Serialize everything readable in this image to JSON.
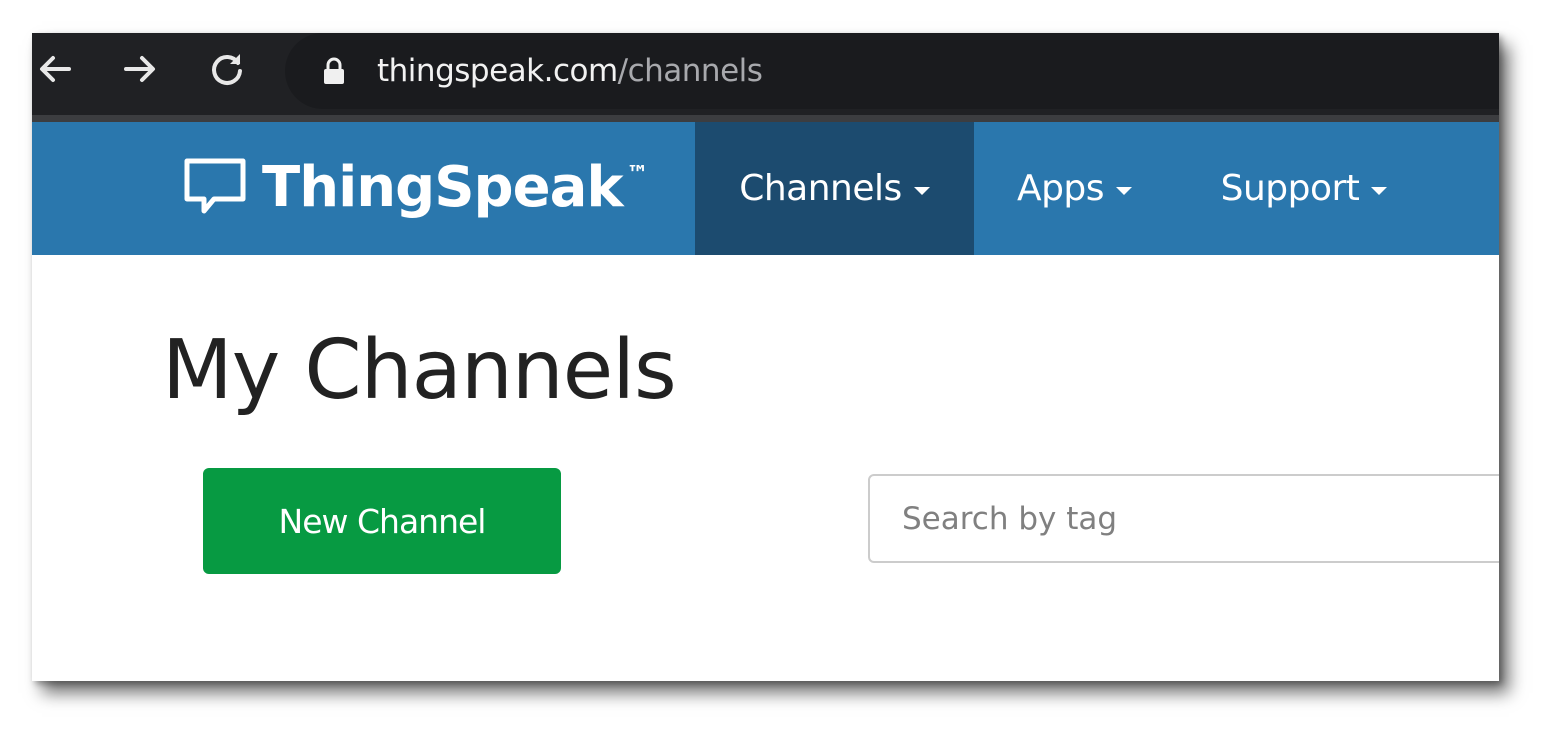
{
  "browser": {
    "url_host": "thingspeak.com",
    "url_path": "/channels"
  },
  "navbar": {
    "brand_name": "ThingSpeak",
    "brand_tm": "™",
    "items": [
      {
        "label": "Channels",
        "active": true
      },
      {
        "label": "Apps",
        "active": false
      },
      {
        "label": "Support",
        "active": false
      }
    ]
  },
  "main": {
    "title": "My Channels",
    "new_channel_label": "New Channel",
    "search_placeholder": "Search by tag"
  },
  "colors": {
    "navbar_bg": "#2a77ad",
    "navbar_active_bg": "#1c4b6f",
    "button_green": "#079a42",
    "browser_bar_bg": "#202124"
  },
  "icons": {
    "back": "arrow-left-icon",
    "forward": "arrow-right-icon",
    "reload": "reload-icon",
    "lock": "lock-icon",
    "logo": "speech-bubble-icon",
    "dropdown": "caret-down-icon"
  }
}
